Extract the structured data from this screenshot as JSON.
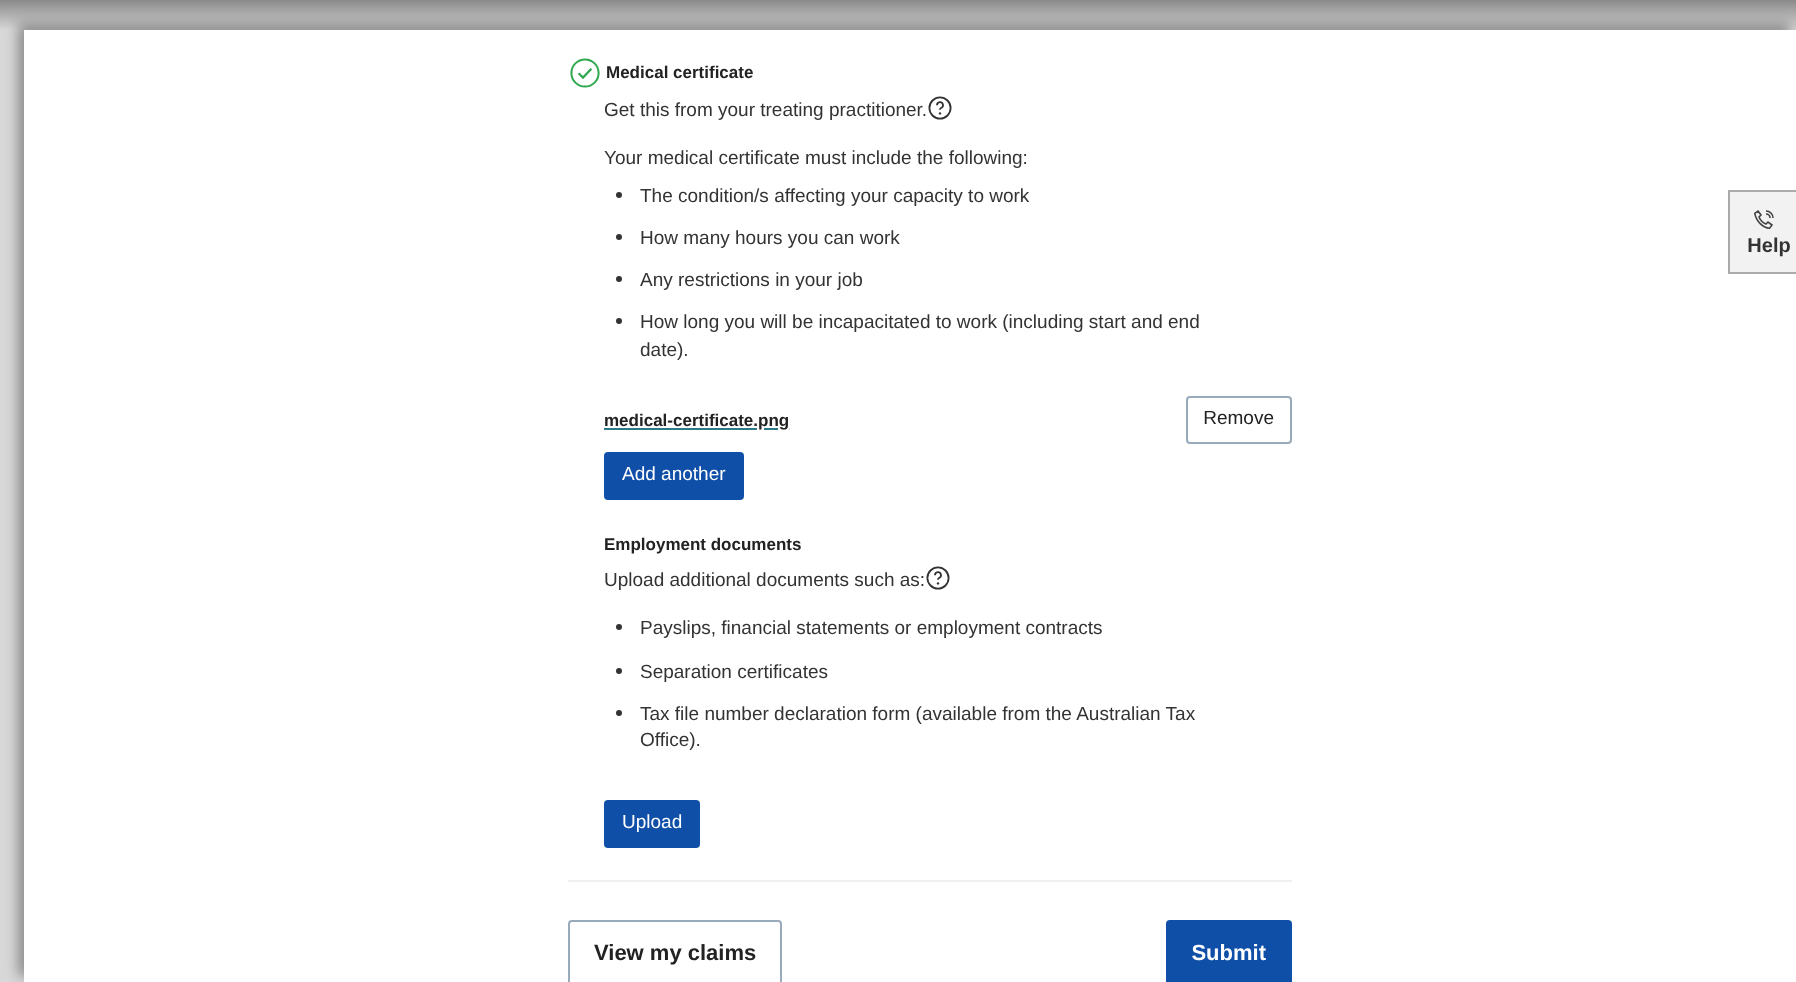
{
  "medical_certificate": {
    "title": "Medical certificate",
    "complete": true,
    "hint": "Get this from your treating practitioner.",
    "intro": "Your medical certificate must include the following:",
    "items": [
      "The condition/s affecting your capacity to work",
      "How many hours you can work",
      "Any restrictions in your job",
      "How long you will be incapacitated to work (including start and end date)."
    ],
    "file": {
      "name": "medical-certificate.png",
      "remove": "Remove"
    },
    "add_button": "Add another"
  },
  "employment_documents": {
    "title": "Employment documents",
    "hint": "Upload additional documents such as:",
    "items": [
      "Payslips, financial statements or employment contracts",
      "Separation certificates",
      "Tax file number declaration form (available from the Australian Tax Office)."
    ],
    "upload_button": "Upload"
  },
  "actions": {
    "secondary": "View my claims",
    "primary": "Submit"
  },
  "help_tab": {
    "label": "Help"
  }
}
